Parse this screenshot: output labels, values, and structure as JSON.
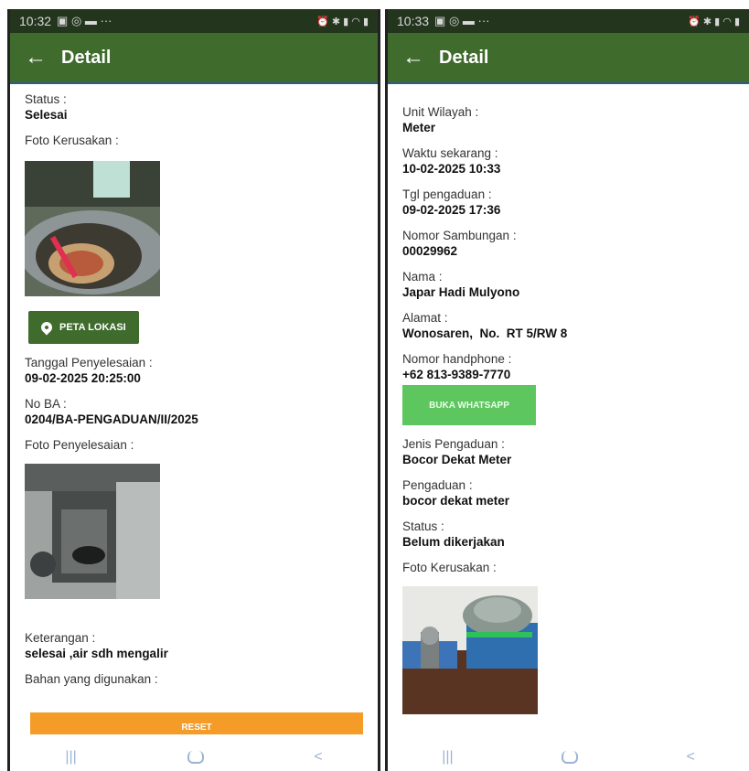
{
  "left": {
    "status_time": "10:32",
    "title": "Detail",
    "fields1": [
      {
        "label": "Status :",
        "value": "Selesai"
      }
    ],
    "foto_kerusakan_label": "Foto Kerusakan :",
    "peta_button": "PETA LOKASI",
    "fields2": [
      {
        "label": "Tanggal Penyelesaian :",
        "value": "09-02-2025 20:25:00"
      },
      {
        "label": "No BA :",
        "value": "0204/BA-PENGADUAN/II/2025"
      }
    ],
    "foto_penyelesaian_label": "Foto Penyelesaian :",
    "fields3": [
      {
        "label": "Keterangan :",
        "value": "selesai ,air sdh mengalir"
      }
    ],
    "bahan_label": "Bahan yang digunakan :",
    "reset_button": "RESET"
  },
  "right": {
    "status_time": "10:33",
    "title": "Detail",
    "fields1": [
      {
        "label": "Unit Wilayah :",
        "value": "Meter"
      },
      {
        "label": "Waktu sekarang :",
        "value": "10-02-2025 10:33"
      },
      {
        "label": "Tgl pengaduan :",
        "value": "09-02-2025 17:36"
      },
      {
        "label": "Nomor Sambungan :",
        "value": "00029962"
      },
      {
        "label": "Nama :",
        "value": "Japar Hadi Mulyono"
      },
      {
        "label": "Alamat :",
        "value": "Wonosaren,  No.  RT 5/RW 8"
      },
      {
        "label": "Nomor handphone :",
        "value": "+62 813-9389-7770"
      }
    ],
    "wa_button": "BUKA WHATSAPP",
    "fields2": [
      {
        "label": "Jenis Pengaduan :",
        "value": "Bocor Dekat Meter"
      },
      {
        "label": "Pengaduan :",
        "value": "bocor dekat meter"
      },
      {
        "label": "Status :",
        "value": "Belum dikerjakan"
      }
    ],
    "foto_kerusakan_label": "Foto Kerusakan :"
  },
  "colors": {
    "appbar": "#3f6b2c",
    "statusbar": "#23351d",
    "whatsapp": "#4cc04e",
    "reset": "#f49b28"
  },
  "icons": [
    "back-arrow-icon",
    "location-pin-icon",
    "recents-icon",
    "home-icon",
    "back-nav-icon"
  ]
}
